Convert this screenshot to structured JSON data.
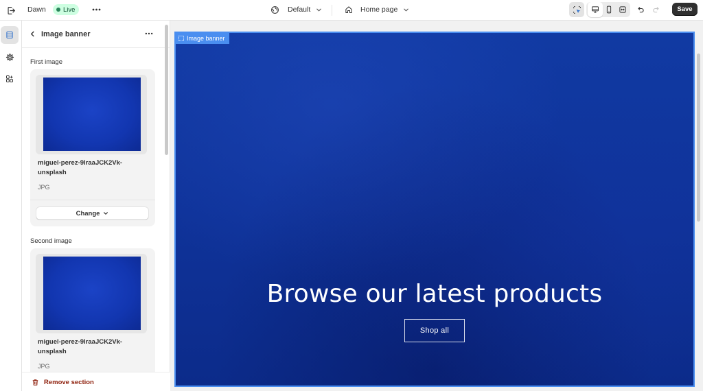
{
  "topbar": {
    "theme_name": "Dawn",
    "live_label": "Live",
    "preset_label": "Default",
    "page_label": "Home page",
    "save_label": "Save"
  },
  "panel": {
    "title": "Image banner",
    "first_image": {
      "label": "First image",
      "file_name": "miguel-perez-9lraaJCK2Vk-unsplash",
      "file_type": "JPG",
      "change_label": "Change"
    },
    "second_image": {
      "label": "Second image",
      "file_name": "miguel-perez-9lraaJCK2Vk-unsplash",
      "file_type": "JPG"
    },
    "remove_label": "Remove section"
  },
  "preview": {
    "section_tag": "Image banner",
    "heading": "Browse our latest products",
    "button_label": "Shop all"
  },
  "colors": {
    "banner_blue": "#0f339a",
    "selection_blue": "#4a8ef0",
    "live_green": "#29845a",
    "remove_red": "#8e1f0b"
  },
  "icons": {
    "exit": "exit-icon",
    "more": "more-horizontal-icon",
    "globe": "globe-icon",
    "home": "home-icon",
    "inspector": "select-inspector-icon",
    "desktop": "desktop-icon",
    "mobile": "mobile-icon",
    "fullwidth": "fullwidth-icon",
    "undo": "undo-icon",
    "redo": "redo-icon",
    "sections": "sections-icon",
    "settings": "gear-icon",
    "apps": "apps-icon",
    "back": "chevron-left-icon",
    "delete": "trash-icon"
  }
}
